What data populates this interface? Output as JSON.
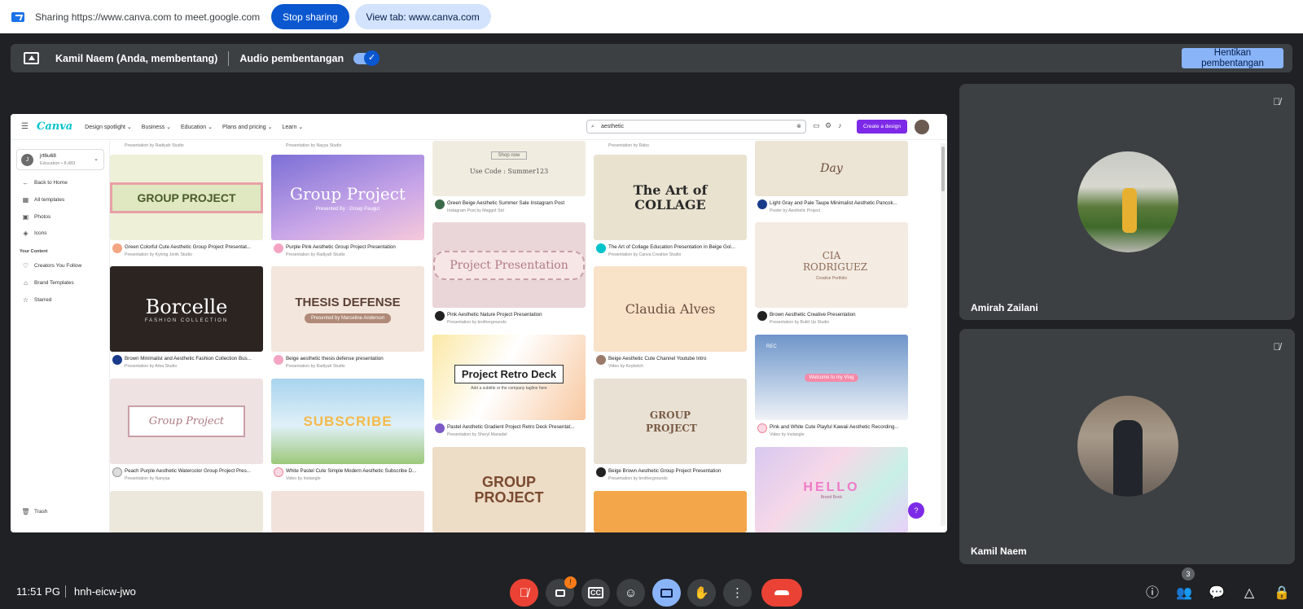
{
  "share_bar": {
    "text": "Sharing https://www.canva.com to meet.google.com",
    "stop_label": "Stop sharing",
    "view_label": "View tab: www.canva.com"
  },
  "present_bar": {
    "presenter": "Kamil Naem (Anda, membentang)",
    "audio_label": "Audio pembentangan",
    "stop_label_line1": "Hentikan",
    "stop_label_line2": "pembentangan"
  },
  "canva": {
    "logo": "Canva",
    "nav": [
      "Design spotlight ⌄",
      "Business ⌄",
      "Education ⌄",
      "Plans and pricing ⌄",
      "Learn ⌄"
    ],
    "search_value": "aesthetic",
    "create_label": "Create a design",
    "account": {
      "initial": "J",
      "name": "jrt6u68",
      "plan": "Education • 8,483"
    },
    "sidebar": [
      {
        "icon": "←",
        "label": "Back to Home"
      },
      {
        "icon": "▦",
        "label": "All templates"
      },
      {
        "icon": "▣",
        "label": "Photos"
      },
      {
        "icon": "◈",
        "label": "Icons"
      }
    ],
    "your_content_head": "Your Content",
    "sidebar2": [
      {
        "icon": "♡",
        "label": "Creators You Follow"
      },
      {
        "icon": "⌂",
        "label": "Brand Templates"
      },
      {
        "icon": "☆",
        "label": "Starred"
      }
    ],
    "trash": "Trash",
    "help": "?",
    "templates": [
      {
        "title": "GROUP PROJECT",
        "cap": "Green Colorful Cute Aesthetic Group Project Presentat...",
        "sub": "Presentation by Kyning Jenik Studio"
      },
      {
        "title": "Group Project",
        "sub_title": "Presented By : Group Paugut",
        "cap": "Purple Pink Aesthetic Group Project Presentation",
        "sub": "Presentation by Radiyah Studio"
      },
      {
        "title": "Borcelle",
        "sub_title": "FASHION COLLECTION",
        "cap": "Brown Minimalist and Aesthetic Fashion Collection Bus...",
        "sub": "Presentation by Arba Studio"
      },
      {
        "title": "THESIS DEFENSE",
        "sub_title": "Presented by Marceline Anderson",
        "cap": "Beige aesthetic thesis defense presentation",
        "sub": "Presentation by Radiyah Studio"
      },
      {
        "title": "Group Project",
        "cap": "Peach Purple Aesthetic Watercolor Group Project Pres...",
        "sub": "Presentation by Nanyaa"
      },
      {
        "title": "SUBSCRIBE",
        "cap": "White Pastel Cute Simple Modern Aesthetic Subscribe D...",
        "sub": "Video by Instangle"
      },
      {
        "title": "Shop now",
        "sub_title": "Use Code : Summer123",
        "cap": "Green Beige Aesthetic Summer Sale Instagram Post",
        "sub": "Instagram Post by Maggot Std"
      },
      {
        "title": "Project Presentation",
        "cap": "Pink Aesthetic Nature Project Presentation",
        "sub": "Presentation by brothergrounds"
      },
      {
        "title": "Project Retro Deck",
        "sub_title": "Add a subtitle or the company tagline here",
        "cap": "Pastel Aesthetic Gradient Project Retro Deck Presentat...",
        "sub": "Presentation by Sheryl Manadel"
      },
      {
        "title": "GROUP PROJECT",
        "cap": "",
        "sub": ""
      },
      {
        "title": "The Art of COLLAGE",
        "cap": "The Art of Collage Education Presentation in Beige Gol...",
        "sub": "Presentation by Canva Creative Studio"
      },
      {
        "title": "Claudia Alves",
        "cap": "Beige Aesthetic Cute Channel Youtube Intro",
        "sub": "Video by Keyketch"
      },
      {
        "title": "GROUP PROJECT",
        "cap": "Beige Brown Aesthetic Group Project Presentation",
        "sub": "Presentation by brothergrounds"
      },
      {
        "title": "Day",
        "cap": "Light Gray and Pale Taupe Minimalist Aesthetic Pancok...",
        "sub": "Poster by Aesthetic Project"
      },
      {
        "title": "CIA RODRIGUEZ",
        "sub_title": "Creative Portfolio",
        "cap": "Brown Aesthetic Creative Presentation",
        "sub": "Presentation by Build Up Studio"
      },
      {
        "title": "Welcome to my Vlog",
        "rec": "REC",
        "cap": "Pink and White Cute Playful Kawaii Aesthetic Recording...",
        "sub": "Video by Instangle"
      },
      {
        "title": "HELLO",
        "sub_title": "Brand Book",
        "cap": "",
        "sub": ""
      }
    ],
    "top_row_caps": [
      "Presentation by Radiyah Studio",
      "Presentation by Nayya Studio",
      "Presentation by Rabo"
    ]
  },
  "participants": [
    {
      "name": "Amirah Zailani"
    },
    {
      "name": "Kamil Naem"
    }
  ],
  "bottom": {
    "time": "11:51 PG",
    "code": "hnh-eicw-jwo",
    "people_count": "3",
    "camera_badge": "!"
  },
  "colors": {
    "meet_bg": "#202124",
    "tile_bg": "#3c4043",
    "end_call": "#ea4335",
    "accent_blue": "#8ab4f8",
    "canva_purple": "#7d2ae8"
  }
}
